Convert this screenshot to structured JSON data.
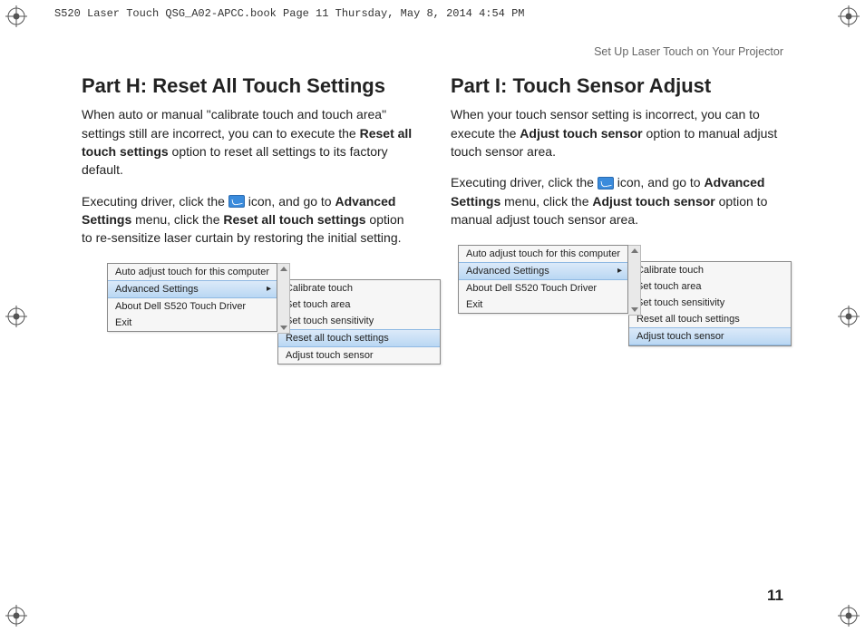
{
  "bookline": "S520 Laser Touch QSG_A02-APCC.book  Page 11  Thursday, May 8, 2014  4:54 PM",
  "header": "Set Up Laser Touch on Your Projector",
  "page_number": "11",
  "left": {
    "title": "Part H: Reset All Touch Settings",
    "p1a": "When auto or manual \"calibrate touch and touch area\" settings still are incorrect, you can to execute the ",
    "p1b_bold": "Reset all touch settings",
    "p1c": " option to reset all settings to its factory default.",
    "p2a": "Executing driver, click the ",
    "p2b": " icon, and go to ",
    "p2c_bold": "Advanced Settings",
    "p2d": " menu, click the ",
    "p2e_bold": "Reset all touch settings",
    "p2f": " option to re-sensitize laser curtain by restoring the initial setting."
  },
  "right": {
    "title": "Part I: Touch Sensor Adjust",
    "p1a": "When your touch sensor setting is incorrect, you can to execute the ",
    "p1b_bold": "Adjust touch sensor",
    "p1c": " option to manual adjust touch sensor area.",
    "p2a": "Executing driver, click the ",
    "p2b": " icon, and go to ",
    "p2c_bold": "Advanced Settings",
    "p2d": " menu, click the ",
    "p2e_bold": "Adjust touch sensor",
    "p2f": " option to manual adjust touch sensor area."
  },
  "menu_main": {
    "items": [
      "Auto adjust touch for this computer",
      "Advanced Settings",
      "About Dell S520 Touch Driver",
      "Exit"
    ]
  },
  "menu_sub": {
    "items": [
      "Calibrate touch",
      "Set touch area",
      "Set touch sensitivity",
      "Reset all touch settings",
      "Adjust touch sensor"
    ]
  }
}
